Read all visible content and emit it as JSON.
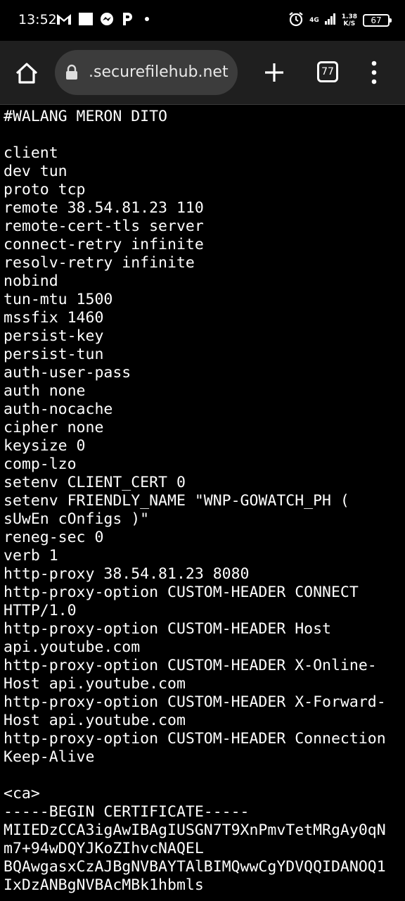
{
  "status_bar": {
    "time": "13:52",
    "network": "4G",
    "speed": "1.38",
    "speed_unit": "K/S",
    "battery": "67"
  },
  "browser": {
    "url": ".securefilehub.net",
    "tab_count": "77",
    "icons": [
      "home-icon",
      "lock-icon",
      "plus-icon",
      "tabs-icon",
      "more-vert-icon"
    ]
  },
  "file": {
    "lines": [
      "#WALANG MERON DITO",
      "",
      "client",
      "dev tun",
      "proto tcp",
      "remote 38.54.81.23 110",
      "remote-cert-tls server",
      "connect-retry infinite",
      "resolv-retry infinite",
      "nobind",
      "tun-mtu 1500",
      "mssfix 1460",
      "persist-key",
      "persist-tun",
      "auth-user-pass",
      "auth none",
      "auth-nocache",
      "cipher none",
      "keysize 0",
      "comp-lzo",
      "setenv CLIENT_CERT 0",
      "setenv FRIENDLY_NAME \"WNP-GOWATCH_PH (",
      "sUwEn cOnfigs )\"",
      "reneg-sec 0",
      "verb 1",
      "http-proxy 38.54.81.23 8080",
      "http-proxy-option CUSTOM-HEADER CONNECT",
      "HTTP/1.0",
      "http-proxy-option CUSTOM-HEADER Host",
      "api.youtube.com",
      "http-proxy-option CUSTOM-HEADER X-Online-",
      "Host api.youtube.com",
      "http-proxy-option CUSTOM-HEADER X-Forward-",
      "Host api.youtube.com",
      "http-proxy-option CUSTOM-HEADER Connection",
      "Keep-Alive",
      "",
      "<ca>",
      "-----BEGIN CERTIFICATE-----",
      "MIIEDzCCA3igAwIBAgIUSGN7T9XnPmvTetMRgAy0qN",
      "m7+94wDQYJKoZIhvcNAQEL",
      "BQAwgasxCzAJBgNVBAYTAlBIMQwwCgYDVQQIDANOQ1",
      "IxDzANBgNVBAcMBk1hbmls"
    ]
  }
}
